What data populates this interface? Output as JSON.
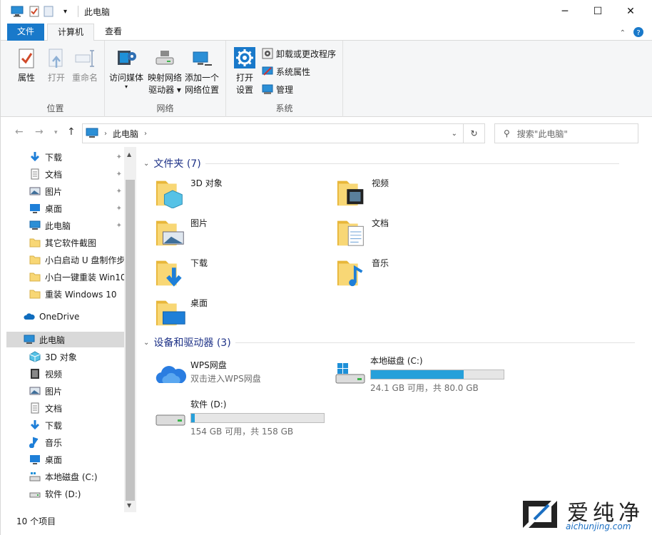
{
  "window": {
    "title": "此电脑",
    "minimize": "─",
    "maximize": "☐",
    "close": "✕"
  },
  "tabs": {
    "file": "文件",
    "computer": "计算机",
    "view": "查看"
  },
  "ribbon": {
    "location": {
      "label": "位置",
      "properties": "属性",
      "open": "打开",
      "rename": "重命名"
    },
    "network": {
      "label": "网络",
      "access_media": "访问媒体",
      "map_drive_1": "映射网络",
      "map_drive_2": "驱动器 ▾",
      "add_location_1": "添加一个",
      "add_location_2": "网络位置"
    },
    "system": {
      "label": "系统",
      "open_settings_1": "打开",
      "open_settings_2": "设置",
      "uninstall": "卸载或更改程序",
      "system_properties": "系统属性",
      "manage": "管理"
    }
  },
  "address": {
    "path": "此电脑",
    "search_placeholder": "搜索\"此电脑\""
  },
  "nav": {
    "quick_access": [
      {
        "label": "下载",
        "icon": "download-arrow-icon",
        "pinned": true
      },
      {
        "label": "文档",
        "icon": "document-icon",
        "pinned": true
      },
      {
        "label": "图片",
        "icon": "pictures-icon",
        "pinned": true
      },
      {
        "label": "桌面",
        "icon": "desktop-icon",
        "pinned": true
      },
      {
        "label": "此电脑",
        "icon": "this-pc-icon",
        "pinned": true
      },
      {
        "label": "其它软件截图",
        "icon": "folder-icon",
        "pinned": false
      },
      {
        "label": "小白启动 U 盘制作步",
        "icon": "folder-icon",
        "pinned": false
      },
      {
        "label": "小白一键重装 Win10",
        "icon": "folder-icon",
        "pinned": false
      },
      {
        "label": "重装 Windows 10",
        "icon": "folder-icon",
        "pinned": false
      }
    ],
    "onedrive": "OneDrive",
    "this_pc": "此电脑",
    "this_pc_children": [
      {
        "label": "3D 对象",
        "icon": "3d-objects-icon"
      },
      {
        "label": "视频",
        "icon": "videos-icon"
      },
      {
        "label": "图片",
        "icon": "pictures-icon"
      },
      {
        "label": "文档",
        "icon": "document-icon"
      },
      {
        "label": "下载",
        "icon": "download-arrow-icon"
      },
      {
        "label": "音乐",
        "icon": "music-icon"
      },
      {
        "label": "桌面",
        "icon": "desktop-icon"
      },
      {
        "label": "本地磁盘 (C:)",
        "icon": "drive-c-icon"
      },
      {
        "label": "软件 (D:)",
        "icon": "drive-icon"
      }
    ]
  },
  "content": {
    "folders_header": "文件夹 (7)",
    "folders": [
      {
        "label": "3D 对象",
        "icon": "3d-objects-folder-icon"
      },
      {
        "label": "视频",
        "icon": "videos-folder-icon"
      },
      {
        "label": "图片",
        "icon": "pictures-folder-icon"
      },
      {
        "label": "文档",
        "icon": "documents-folder-icon"
      },
      {
        "label": "下载",
        "icon": "downloads-folder-icon"
      },
      {
        "label": "音乐",
        "icon": "music-folder-icon"
      },
      {
        "label": "桌面",
        "icon": "desktop-folder-icon"
      }
    ],
    "devices_header": "设备和驱动器 (3)",
    "wps": {
      "name": "WPS网盘",
      "sub": "双击进入WPS网盘"
    },
    "drive_c": {
      "name": "本地磁盘 (C:)",
      "free": "24.1 GB 可用，共 80.0 GB",
      "used_fraction": 0.7
    },
    "drive_d": {
      "name": "软件 (D:)",
      "free": "154 GB 可用，共 158 GB",
      "used_fraction": 0.025
    }
  },
  "status": {
    "count": "10 个项目"
  },
  "watermark": {
    "main": "爱纯净",
    "sub": "aichunjing.com"
  },
  "colors": {
    "accent": "#1979ca",
    "bar": "#26a0da",
    "folder": "#f8d775"
  }
}
